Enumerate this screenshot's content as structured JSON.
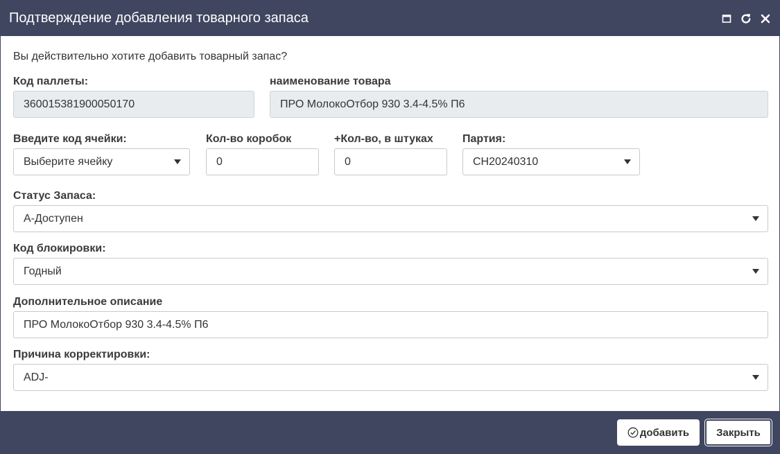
{
  "dialog": {
    "title": "Подтверждение добавления товарного запаса",
    "question": "Вы действительно хотите добавить товарный запас?"
  },
  "fields": {
    "pallet_code": {
      "label": "Код паллеты:",
      "value": "360015381900050170"
    },
    "product_name": {
      "label": "наименование товара",
      "value": "ПРО МолокоОтбор 930 3.4-4.5% П6"
    },
    "cell_code": {
      "label": "Введите код ячейки:",
      "value": "Выберите ячейку"
    },
    "box_qty": {
      "label": "Кол-во коробок",
      "value": "0"
    },
    "piece_qty": {
      "label": "+Кол-во, в штуках",
      "value": "0"
    },
    "batch": {
      "label": "Партия:",
      "value": "CH20240310"
    },
    "stock_status": {
      "label": "Статус Запаса:",
      "value": "А-Доступен"
    },
    "block_code": {
      "label": "Код блокировки:",
      "value": "Годный"
    },
    "extra_description": {
      "label": "Дополнительное описание",
      "value": "ПРО МолокоОтбор 930 3.4-4.5% П6"
    },
    "adjust_reason": {
      "label": "Причина корректировки:",
      "value": "ADJ-"
    }
  },
  "footer": {
    "add_label": "добавить",
    "close_label": "Закрыть"
  },
  "icons": {
    "maximize": "maximize-icon",
    "refresh": "refresh-icon",
    "close": "close-icon",
    "check": "check-circle-icon"
  },
  "colors": {
    "header_bg": "#404660",
    "readonly_bg": "#e9ecef"
  }
}
